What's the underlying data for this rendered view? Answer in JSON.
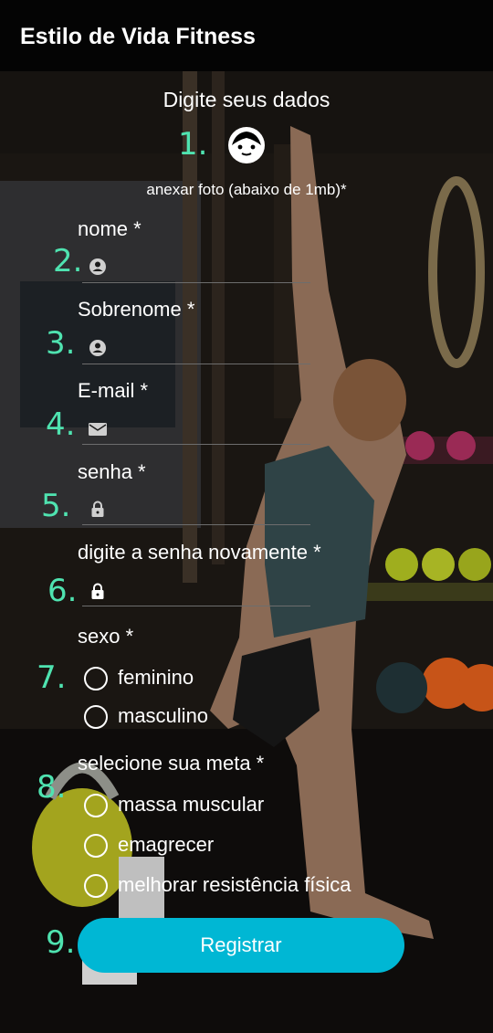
{
  "app": {
    "title": "Estilo de Vida Fitness"
  },
  "form": {
    "heading": "Digite seus dados",
    "photo_label": "anexar foto (abaixo de 1mb)*",
    "numbers": [
      "1.",
      "2.",
      "3.",
      "4.",
      "5.",
      "6.",
      "7.",
      "8.",
      "9."
    ],
    "fields": {
      "nome": {
        "label": "nome *",
        "value": "",
        "icon": "person-icon"
      },
      "sobrenome": {
        "label": "Sobrenome *",
        "value": "",
        "icon": "person-icon"
      },
      "email": {
        "label": "E-mail *",
        "value": "",
        "icon": "mail-icon"
      },
      "senha": {
        "label": "senha *",
        "value": "",
        "icon": "lock-icon"
      },
      "senha2": {
        "label": "digite a senha novamente *",
        "value": "",
        "icon": "lock-icon"
      }
    },
    "sexo": {
      "label": "sexo *",
      "options": [
        "feminino",
        "masculino"
      ]
    },
    "meta": {
      "label": "selecione sua meta *",
      "options": [
        "massa muscular",
        "emagrecer",
        "melhorar resistência física"
      ]
    },
    "register_label": "Registrar"
  },
  "colors": {
    "accent": "#00b7d4",
    "number_color": "#4fe3b0",
    "appbar": "#040404"
  }
}
